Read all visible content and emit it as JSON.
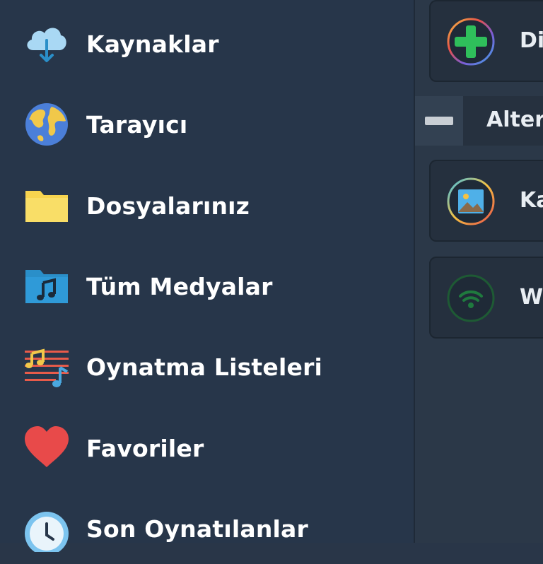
{
  "nav": {
    "items": [
      {
        "label": "Kaynaklar",
        "icon": "cloud-download-icon"
      },
      {
        "label": "Tarayıcı",
        "icon": "globe-icon"
      },
      {
        "label": "Dosyalarınız",
        "icon": "folder-icon"
      },
      {
        "label": "Tüm Medyalar",
        "icon": "music-folder-icon"
      },
      {
        "label": "Oynatma Listeleri",
        "icon": "playlist-icon"
      },
      {
        "label": "Favoriler",
        "icon": "heart-icon"
      },
      {
        "label": "Son Oynatılanlar",
        "icon": "clock-icon"
      }
    ]
  },
  "right_pane": {
    "card_other": {
      "label": "Diğ",
      "icon": "add-circle-icon"
    },
    "section": {
      "label": "Altern",
      "icon": "minus-icon"
    },
    "card_gallery": {
      "label": "Ka",
      "icon": "image-icon"
    },
    "card_wifi": {
      "label": "Wi",
      "icon": "wifi-icon"
    }
  },
  "colors": {
    "drawer_bg": "#27364a",
    "pane_bg": "#2b3848",
    "card_bg": "#25303e",
    "text": "#ffffff",
    "accent_green": "#2fbf5b",
    "heart_red": "#e84a4a",
    "folder_yellow": "#f7d44f",
    "music_blue": "#2a8fc9",
    "cloud_blue": "#a9d8f4"
  }
}
